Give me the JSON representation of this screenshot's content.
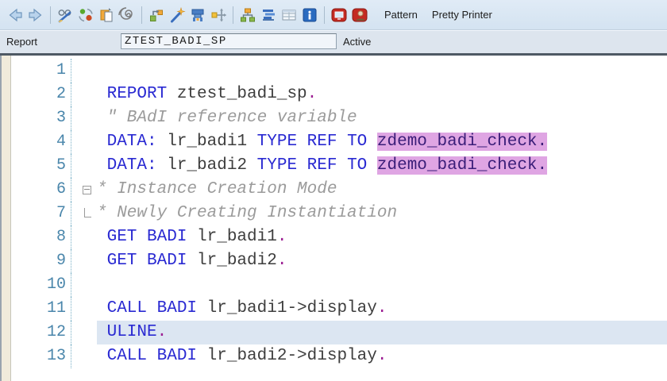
{
  "toolbar": {
    "icons": [
      "back",
      "forward",
      "display-change",
      "refresh",
      "copy",
      "where-used",
      "other-object",
      "pattern-wand",
      "syntax-check",
      "navigate",
      "hierarchy",
      "pretty-align",
      "table-view",
      "info",
      "help-display",
      "help-user"
    ],
    "pattern_label": "Pattern",
    "pretty_printer_label": "Pretty Printer"
  },
  "report_bar": {
    "label": "Report",
    "value": "ZTEST_BADI_SP",
    "status": "Active"
  },
  "editor": {
    "colors": {
      "kw": "#2a2ad2",
      "txt": "#3e3e3e",
      "cmt": "#9b9b9b",
      "dot": "#9c1f93",
      "hlbg": "#dfa5e3",
      "hlfg": "#3a1d78",
      "linehl": "#dce6f2",
      "num": "#4a86ab"
    },
    "lines": [
      {
        "num": "1",
        "fold": "",
        "current": false,
        "segs": []
      },
      {
        "num": "2",
        "fold": "",
        "current": false,
        "segs": [
          {
            "t": " REPORT",
            "c": "kw"
          },
          {
            "t": " ztest_badi_sp",
            "c": "txt"
          },
          {
            "t": ".",
            "c": "dot"
          }
        ]
      },
      {
        "num": "3",
        "fold": "",
        "current": false,
        "segs": [
          {
            "t": " \" BAdI reference variable",
            "c": "cmt"
          }
        ]
      },
      {
        "num": "4",
        "fold": "",
        "current": false,
        "segs": [
          {
            "t": " DATA:",
            "c": "kw"
          },
          {
            "t": " lr_badi1 ",
            "c": "txt"
          },
          {
            "t": "TYPE REF TO",
            "c": "kw"
          },
          {
            "t": " ",
            "c": "txt"
          },
          {
            "t": "zdemo_badi_check.",
            "c": "hl"
          }
        ]
      },
      {
        "num": "5",
        "fold": "",
        "current": false,
        "segs": [
          {
            "t": " DATA:",
            "c": "kw"
          },
          {
            "t": " lr_badi2 ",
            "c": "txt"
          },
          {
            "t": "TYPE REF TO",
            "c": "kw"
          },
          {
            "t": " ",
            "c": "txt"
          },
          {
            "t": "zdemo_badi_check.",
            "c": "hl"
          }
        ]
      },
      {
        "num": "6",
        "fold": "minus",
        "current": false,
        "segs": [
          {
            "t": "* Instance Creation Mode",
            "c": "cmt"
          }
        ]
      },
      {
        "num": "7",
        "fold": "corner",
        "current": false,
        "segs": [
          {
            "t": "* Newly Creating Instantiation",
            "c": "cmt"
          }
        ]
      },
      {
        "num": "8",
        "fold": "",
        "current": false,
        "segs": [
          {
            "t": " GET BADI",
            "c": "kw"
          },
          {
            "t": " lr_badi1",
            "c": "txt"
          },
          {
            "t": ".",
            "c": "dot"
          }
        ]
      },
      {
        "num": "9",
        "fold": "",
        "current": false,
        "segs": [
          {
            "t": " GET BADI",
            "c": "kw"
          },
          {
            "t": " lr_badi2",
            "c": "txt"
          },
          {
            "t": ".",
            "c": "dot"
          }
        ]
      },
      {
        "num": "10",
        "fold": "",
        "current": false,
        "segs": []
      },
      {
        "num": "11",
        "fold": "",
        "current": false,
        "segs": [
          {
            "t": " CALL BADI",
            "c": "kw"
          },
          {
            "t": " lr_badi1->display",
            "c": "txt"
          },
          {
            "t": ".",
            "c": "dot"
          }
        ]
      },
      {
        "num": "12",
        "fold": "",
        "current": true,
        "segs": [
          {
            "t": " ULINE",
            "c": "kw"
          },
          {
            "t": ".",
            "c": "dot"
          }
        ]
      },
      {
        "num": "13",
        "fold": "",
        "current": false,
        "segs": [
          {
            "t": " CALL BADI",
            "c": "kw"
          },
          {
            "t": " lr_badi2->display",
            "c": "txt"
          },
          {
            "t": ".",
            "c": "dot"
          }
        ]
      }
    ]
  }
}
